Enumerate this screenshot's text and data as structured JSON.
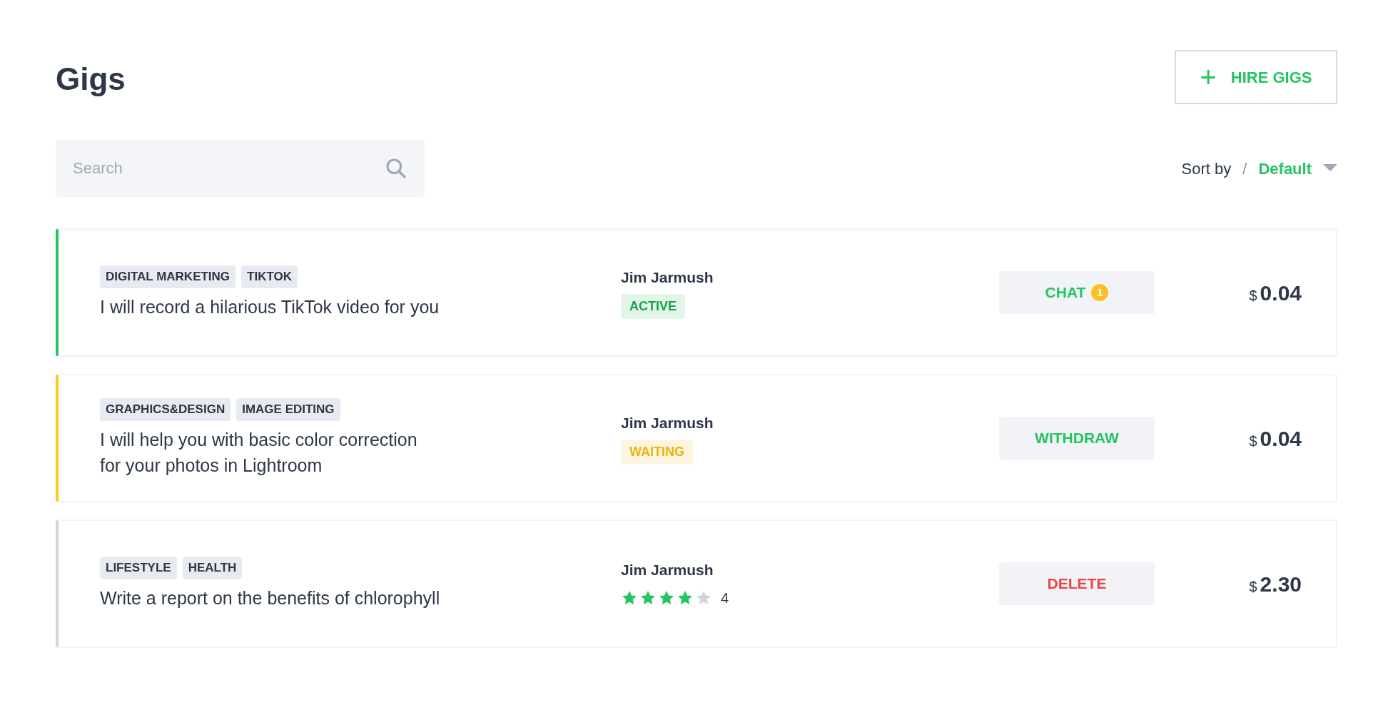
{
  "title": "Gigs",
  "hire_button": {
    "icon": "+",
    "label": "HIRE GIGS"
  },
  "search": {
    "placeholder": "Search"
  },
  "sort": {
    "label": "Sort by",
    "separator": "/",
    "value": "Default"
  },
  "gigs": [
    {
      "color": "#22c55e",
      "tags": [
        "DIGITAL MARKETING",
        "TIKTOK"
      ],
      "title": "I will record a hilarious TikTok video for you",
      "seller": "Jim Jarmush",
      "meta": {
        "kind": "status",
        "label": "ACTIVE",
        "color": "#16a34a"
      },
      "action": {
        "label": "CHAT",
        "color": "#22c55e",
        "badge": "1"
      },
      "currency": "$",
      "price": "0.04"
    },
    {
      "color": "#facc15",
      "tags": [
        "GRAPHICS&DESIGN",
        "IMAGE EDITING"
      ],
      "title": "I will help you with basic color correction\nfor your photos in Lightroom",
      "seller": "Jim Jarmush",
      "meta": {
        "kind": "status",
        "label": "WAITING",
        "color": "#eab308"
      },
      "action": {
        "label": "WITHDRAW",
        "color": "#22c55e"
      },
      "currency": "$",
      "price": "0.04"
    },
    {
      "color": "#d1d5db",
      "tags": [
        "LIFESTYLE",
        "HEALTH"
      ],
      "title": "Write a report on the benefits of chlorophyll",
      "seller": "Jim Jarmush",
      "meta": {
        "kind": "rating",
        "stars": 4,
        "reading": "4"
      },
      "action": {
        "label": "DELETE",
        "color": "#ef4444"
      },
      "currency": "$",
      "price": "2.30"
    }
  ]
}
